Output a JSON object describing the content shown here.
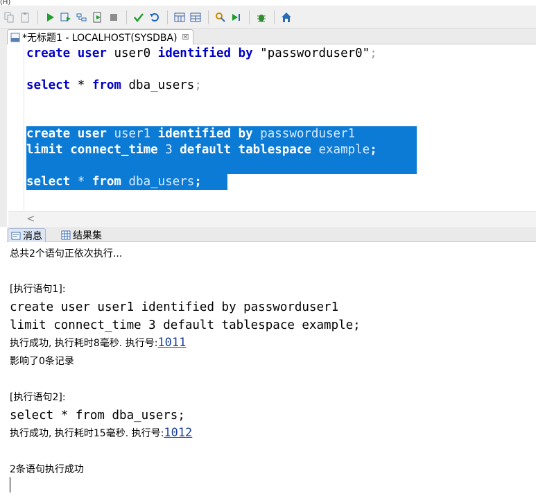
{
  "menu_stub": "(H)",
  "toolbar": {
    "buttons": [
      {
        "name": "copy-icon",
        "color": "#9aa4ae"
      },
      {
        "name": "paste-icon",
        "color": "#9aa4ae"
      },
      {
        "name": "run-icon",
        "color": "#1f9e2e"
      },
      {
        "name": "run-script-icon",
        "color": "#2a6bb5"
      },
      {
        "name": "explain-icon",
        "color": "#2a6bb5"
      },
      {
        "name": "execute-file-icon",
        "color": "#1f9e2e"
      },
      {
        "name": "stop-icon",
        "color": "#8c8c8c"
      },
      {
        "name": "commit-icon",
        "color": "#1f9e2e"
      },
      {
        "name": "rollback-icon",
        "color": "#1f63c7"
      },
      {
        "name": "calendar-grid-icon",
        "color": "#3a5fa8"
      },
      {
        "name": "calendar-grid-2-icon",
        "color": "#3a5fa8"
      },
      {
        "name": "format-icon",
        "color": "#c58b00"
      },
      {
        "name": "step-run-icon",
        "color": "#1f9e2e"
      },
      {
        "name": "debug-bug-icon",
        "color": "#2e8b2e"
      },
      {
        "name": "home-icon",
        "color": "#2a6bb5"
      }
    ]
  },
  "editor": {
    "tab_title": "*无标题1 - LOCALHOST(SYSDBA)",
    "tab_close": "☒",
    "lines": [
      {
        "kw1": "create user",
        "t1": " user0 ",
        "kw2": "identified by",
        "t2": " \"passworduser0\"",
        "semi": ";"
      },
      {
        "kw1": "select",
        "t1": " * ",
        "kw2": "from",
        "t2": " dba_users",
        "semi": ";"
      },
      {
        "kw1": "create user",
        "t1": " user1 ",
        "kw2": "identified by",
        "t2": " passworduser1",
        "semi": ""
      },
      {
        "kw1": "limit connect_time",
        "t1": " 3 ",
        "kw2": "default tablespace",
        "t2": " example",
        "semi": ";"
      },
      {
        "kw1": "select",
        "t1": " * ",
        "kw2": "from",
        "t2": " dba_users",
        "semi": ";"
      }
    ],
    "scroll_left": "<"
  },
  "results": {
    "tabs": [
      {
        "label": "消息",
        "active": true
      },
      {
        "label": "结果集",
        "active": false
      }
    ]
  },
  "output": {
    "summary": "总共2个语句正依次执行...",
    "stmt1_header": "[执行语句1]:",
    "stmt1_sql_1": "create user user1 identified by passworduser1",
    "stmt1_sql_2": "limit connect_time 3 default tablespace example;",
    "stmt1_result_prefix": "执行成功, 执行耗时8毫秒. 执行号:",
    "stmt1_exec_no": "1011",
    "stmt1_affected": "影响了0条记录",
    "stmt2_header": "[执行语句2]:",
    "stmt2_sql": "select * from dba_users;",
    "stmt2_result_prefix": "执行成功, 执行耗时15毫秒. 执行号:",
    "stmt2_exec_no": "1012",
    "final": "2条语句执行成功"
  }
}
